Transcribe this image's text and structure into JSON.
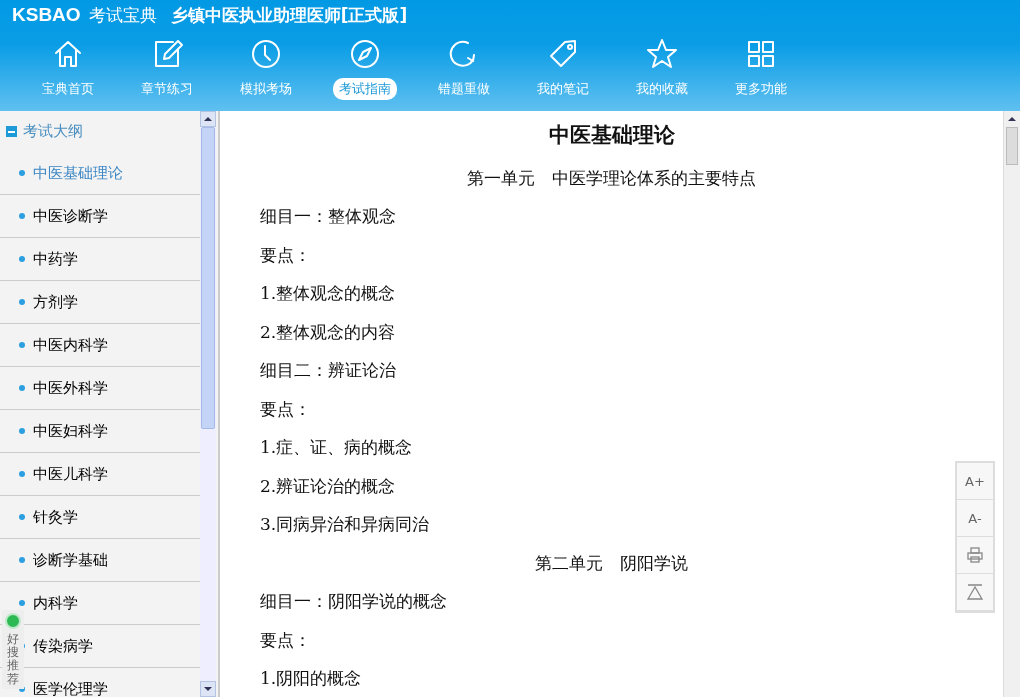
{
  "header": {
    "brand": "KSBAO",
    "brand_cn": "考试宝典",
    "title": "乡镇中医执业助理医师[正式版]"
  },
  "nav": [
    {
      "label": "宝典首页",
      "selected": false
    },
    {
      "label": "章节练习",
      "selected": false
    },
    {
      "label": "模拟考场",
      "selected": false
    },
    {
      "label": "考试指南",
      "selected": true
    },
    {
      "label": "错题重做",
      "selected": false
    },
    {
      "label": "我的笔记",
      "selected": false
    },
    {
      "label": "我的收藏",
      "selected": false
    },
    {
      "label": "更多功能",
      "selected": false
    }
  ],
  "sidebar": {
    "heading": "考试大纲",
    "expanded": true,
    "items": [
      {
        "label": "中医基础理论",
        "selected": true
      },
      {
        "label": "中医诊断学",
        "selected": false
      },
      {
        "label": "中药学",
        "selected": false
      },
      {
        "label": "方剂学",
        "selected": false
      },
      {
        "label": "中医内科学",
        "selected": false
      },
      {
        "label": "中医外科学",
        "selected": false
      },
      {
        "label": "中医妇科学",
        "selected": false
      },
      {
        "label": "中医儿科学",
        "selected": false
      },
      {
        "label": "针灸学",
        "selected": false
      },
      {
        "label": "诊断学基础",
        "selected": false
      },
      {
        "label": "内科学",
        "selected": false
      },
      {
        "label": "传染病学",
        "selected": false
      },
      {
        "label": "医学伦理学",
        "selected": false
      }
    ]
  },
  "content": [
    {
      "kind": "title",
      "text": "中医基础理论"
    },
    {
      "kind": "unit",
      "text": "第一单元　中医学理论体系的主要特点"
    },
    {
      "kind": "para",
      "text": "细目一：整体观念"
    },
    {
      "kind": "para",
      "text": "要点："
    },
    {
      "kind": "para",
      "text": "1.整体观念的概念"
    },
    {
      "kind": "para",
      "text": "2.整体观念的内容"
    },
    {
      "kind": "para",
      "text": "细目二：辨证论治"
    },
    {
      "kind": "para",
      "text": "要点："
    },
    {
      "kind": "para",
      "text": "1.症、证、病的概念"
    },
    {
      "kind": "para",
      "text": "2.辨证论治的概念"
    },
    {
      "kind": "para",
      "text": "3.同病异治和异病同治"
    },
    {
      "kind": "unit",
      "text": "第二单元　阴阳学说"
    },
    {
      "kind": "para",
      "text": "细目一：阴阳学说的概念"
    },
    {
      "kind": "para",
      "text": "要点："
    },
    {
      "kind": "para",
      "text": "1.阴阳的概念"
    }
  ],
  "tools": [
    {
      "kind": "text",
      "label": "A+"
    },
    {
      "kind": "text",
      "label": "A-"
    },
    {
      "kind": "print"
    },
    {
      "kind": "top"
    }
  ],
  "float_badge": {
    "label": "好搜推荐"
  }
}
